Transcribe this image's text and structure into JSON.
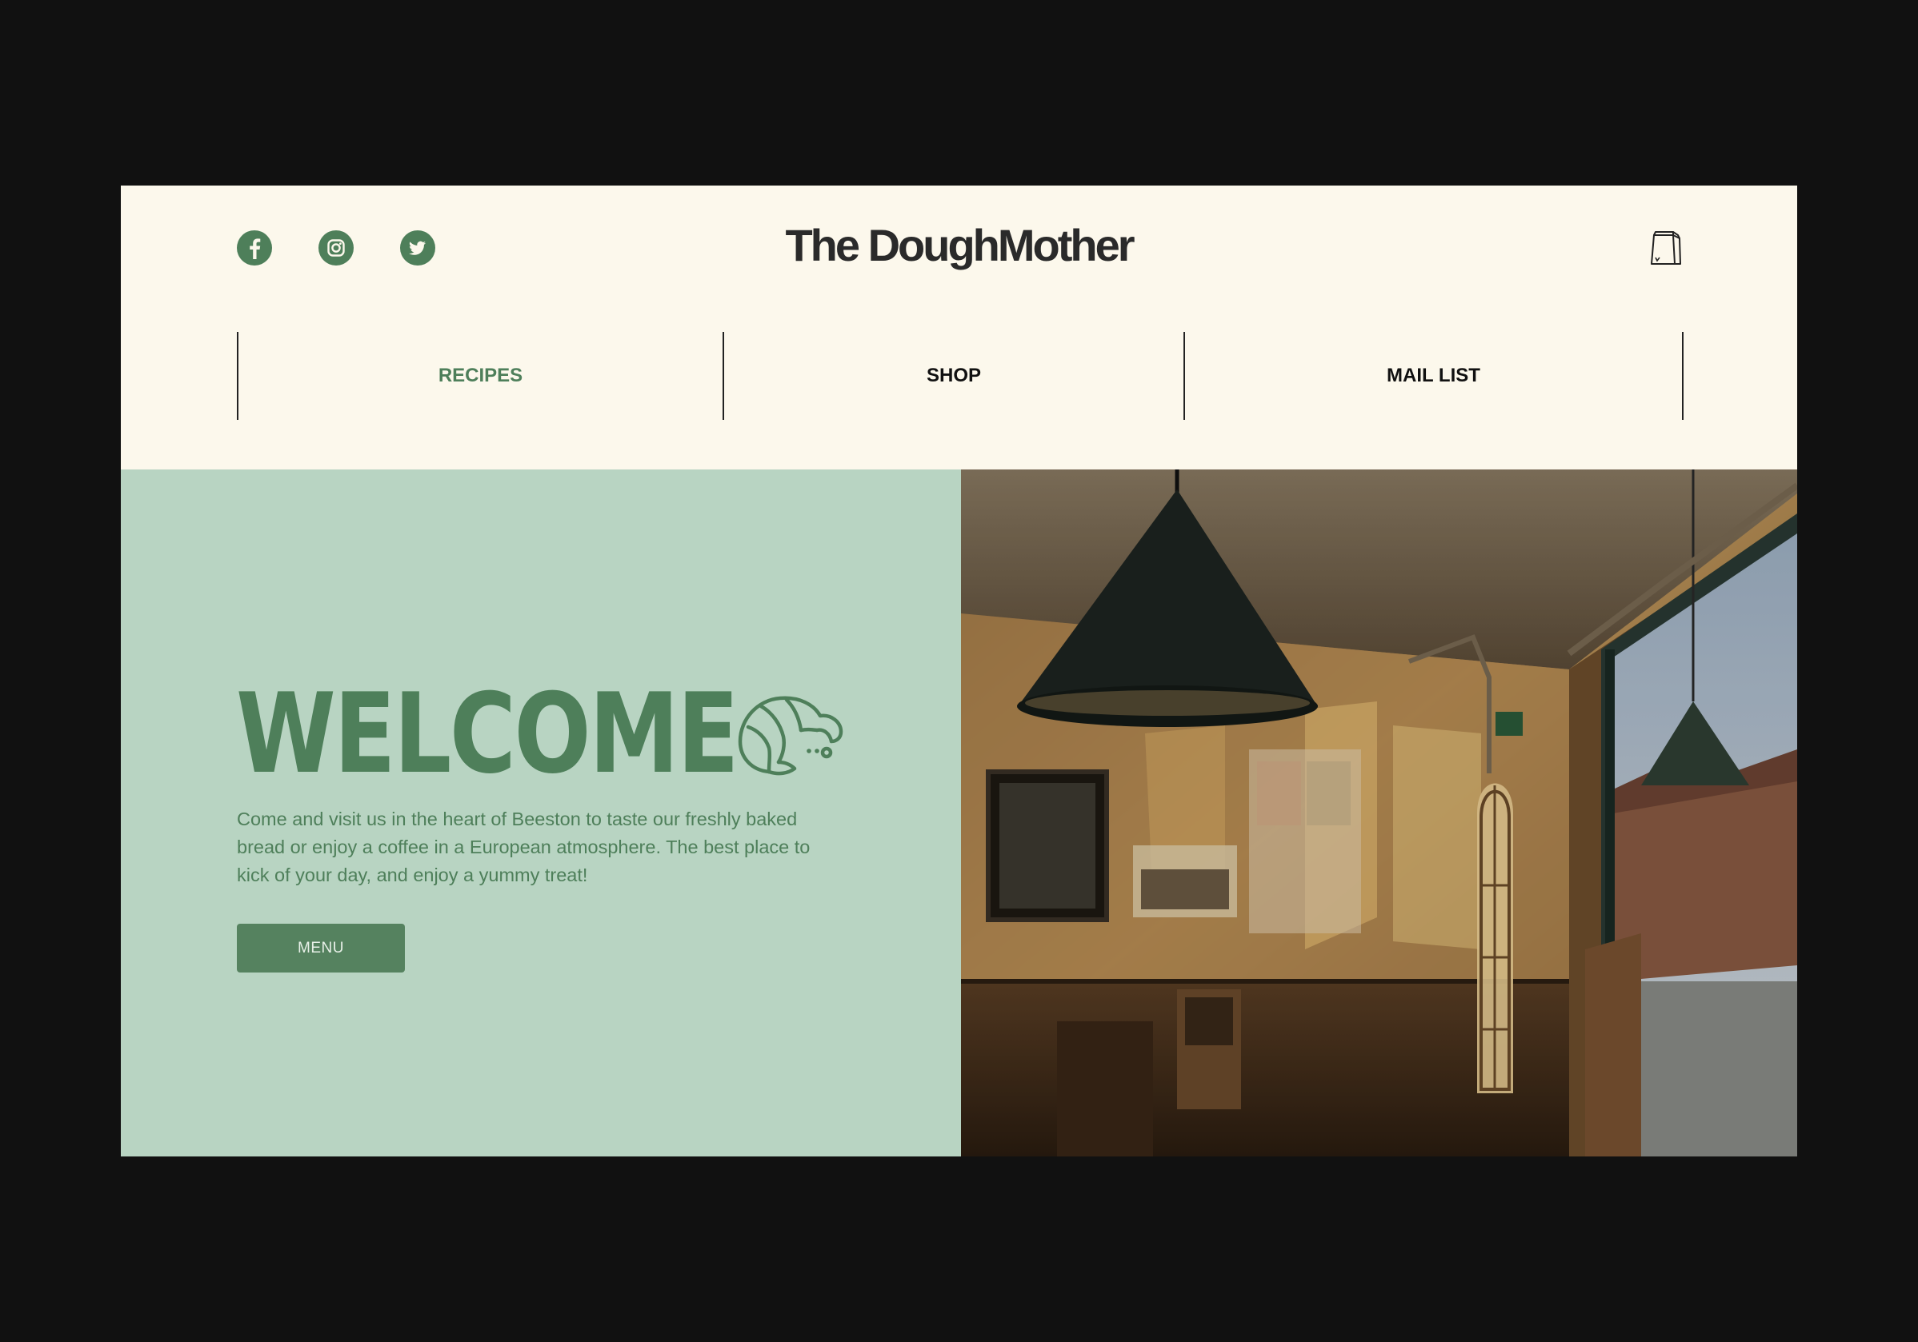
{
  "header": {
    "brand": "The DoughMother",
    "social": [
      {
        "name": "facebook",
        "icon": "facebook-icon"
      },
      {
        "name": "instagram",
        "icon": "instagram-icon"
      },
      {
        "name": "twitter",
        "icon": "twitter-icon"
      }
    ],
    "cart_icon": "shopping-bag-icon"
  },
  "nav": {
    "items": [
      {
        "label": "RECIPES",
        "active": true
      },
      {
        "label": "SHOP",
        "active": false
      },
      {
        "label": "MAIL LIST",
        "active": false
      }
    ]
  },
  "hero": {
    "title": "WELCOME",
    "icon": "croissant-icon",
    "description": "Come and visit us in the heart of Beeston to taste our freshly baked bread or enjoy a coffee in a European atmosphere. The best place to kick of your day, and enjoy a yummy treat!",
    "button_label": "MENU",
    "image": "bakery-interior-photo"
  },
  "colors": {
    "accent": "#4e7f5a",
    "hero_bg": "#b8d4c2",
    "header_bg": "#fcf8ec",
    "backdrop": "#111111"
  }
}
